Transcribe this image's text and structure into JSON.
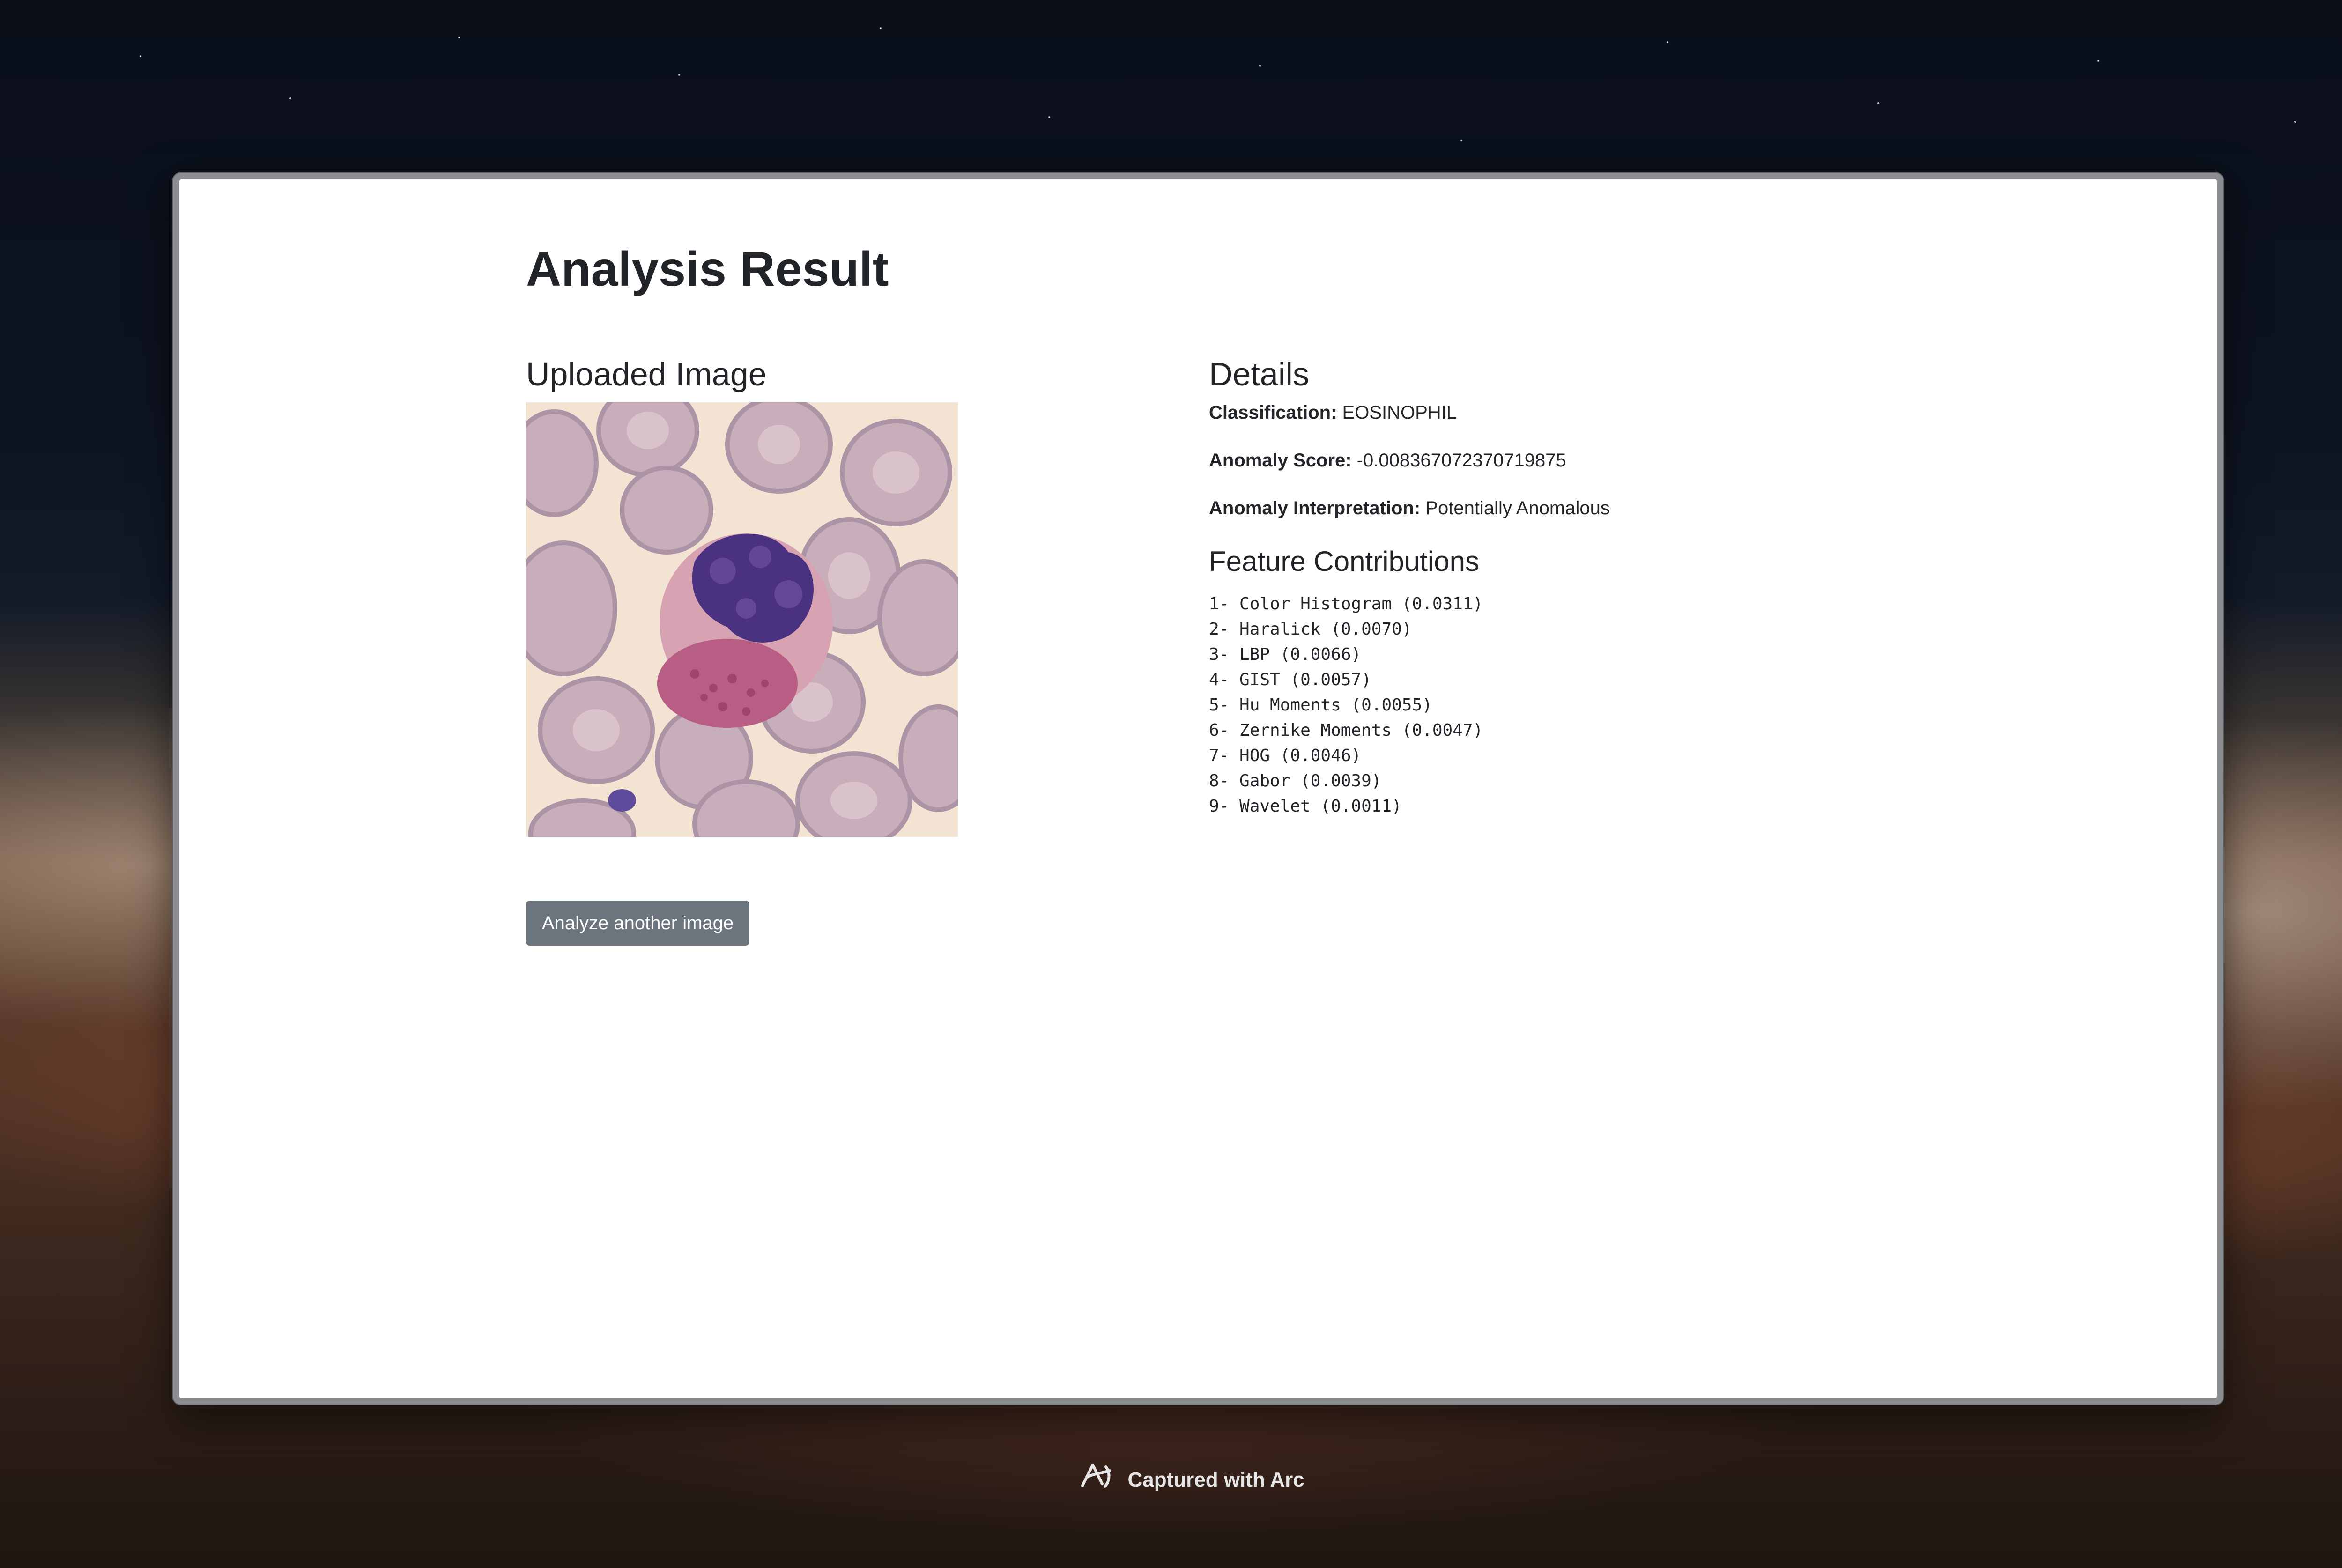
{
  "page": {
    "title": "Analysis Result"
  },
  "uploaded": {
    "title": "Uploaded Image",
    "image_icon": "blood-cell-microscopy-image"
  },
  "details": {
    "title": "Details",
    "classification_label": "Classification:",
    "classification_value": "EOSINOPHIL",
    "anomaly_score_label": "Anomaly Score:",
    "anomaly_score_value": "-0.008367072370719875",
    "anomaly_interpretation_label": "Anomaly Interpretation:",
    "anomaly_interpretation_value": "Potentially Anomalous"
  },
  "features": {
    "title": "Feature Contributions",
    "items": [
      "1- Color Histogram (0.0311)",
      "2- Haralick (0.0070)",
      "3- LBP (0.0066)",
      "4- GIST (0.0057)",
      "5- Hu Moments (0.0055)",
      "6- Zernike Moments (0.0047)",
      "7- HOG (0.0046)",
      "8- Gabor (0.0039)",
      "9- Wavelet (0.0011)"
    ]
  },
  "actions": {
    "analyze_another_label": "Analyze another image"
  },
  "footer": {
    "text": "Captured with Arc",
    "icon": "arc-icon"
  },
  "colors": {
    "button_bg": "#6c757d",
    "text": "#212529",
    "window_border": "#8b8d91"
  }
}
